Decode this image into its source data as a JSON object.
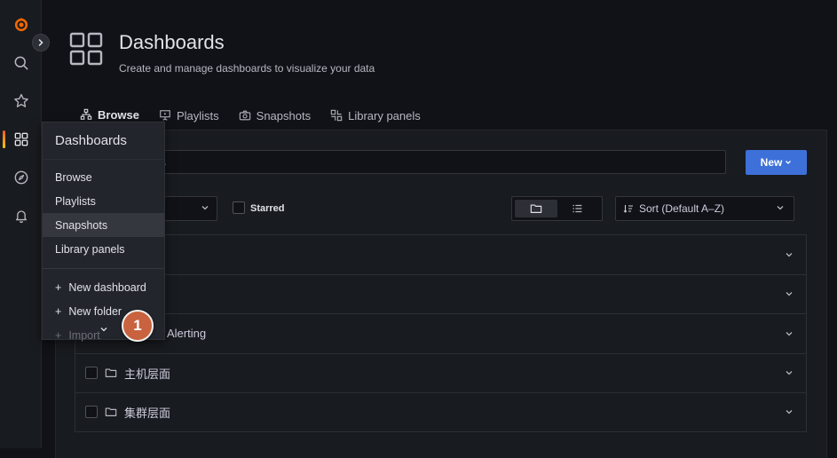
{
  "sidemenu": {
    "items": [
      {
        "icon": "grafana-logo-icon"
      },
      {
        "icon": "search-icon"
      },
      {
        "icon": "star-icon"
      },
      {
        "icon": "dashboards-grid-icon"
      },
      {
        "icon": "explore-compass-icon"
      },
      {
        "icon": "alerting-bell-icon"
      }
    ],
    "expand_icon": "chevron-right-icon"
  },
  "header": {
    "title": "Dashboards",
    "subtitle": "Create and manage dashboards to visualize your data"
  },
  "tabs": [
    {
      "label": "Browse",
      "icon": "sitemap-icon",
      "active": true
    },
    {
      "label": "Playlists",
      "icon": "presentation-play-icon",
      "active": false
    },
    {
      "label": "Snapshots",
      "icon": "camera-icon",
      "active": false
    },
    {
      "label": "Library panels",
      "icon": "library-panel-icon",
      "active": false
    }
  ],
  "search": {
    "visible_text": "oards"
  },
  "new_button": {
    "label": "New",
    "chevron": "⌄"
  },
  "filters": {
    "starred_label": "Starred",
    "sort_label": "Sort (Default A–Z)"
  },
  "folders": [
    {
      "name": ""
    },
    {
      "name": ""
    },
    {
      "name": "Alerting"
    },
    {
      "name": "主机层面"
    },
    {
      "name": "集群层面"
    }
  ],
  "dropdown": {
    "header": "Dashboards",
    "items": [
      {
        "label": "Browse"
      },
      {
        "label": "Playlists"
      },
      {
        "label": "Snapshots"
      },
      {
        "label": "Library panels"
      }
    ],
    "actions": [
      {
        "label": "New dashboard",
        "icon": "+"
      },
      {
        "label": "New folder",
        "icon": "+"
      },
      {
        "label": "Import",
        "icon": "+"
      }
    ]
  },
  "badge": {
    "text": "1"
  },
  "colors": {
    "accent_blue": "#3d71d9",
    "badge": "#c9623e",
    "active_bar_start": "#f05a28",
    "active_bar_end": "#fbca0a"
  }
}
